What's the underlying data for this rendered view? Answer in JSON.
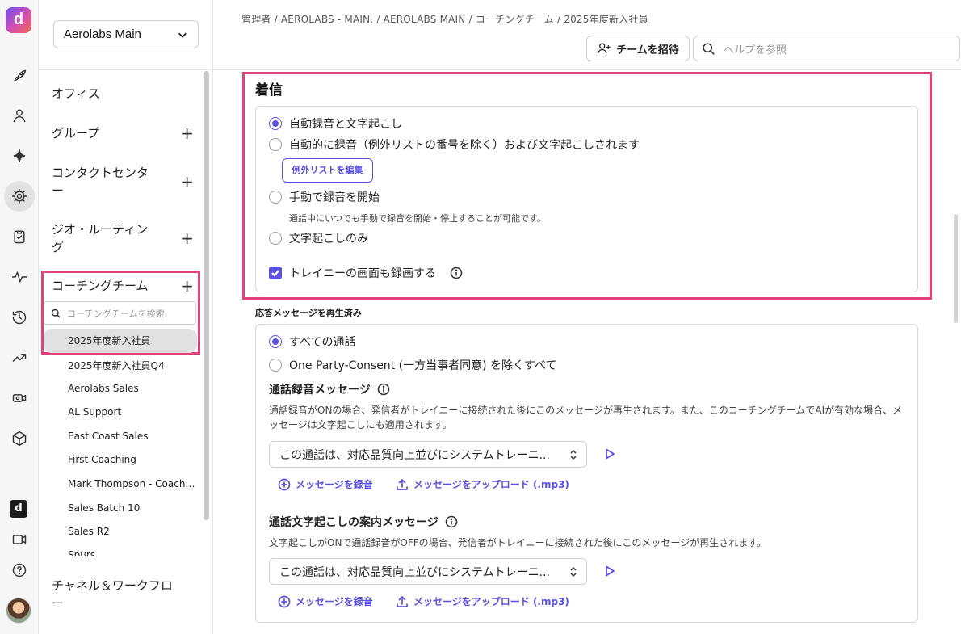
{
  "rail": {
    "logo": "d",
    "dbox": "d",
    "icons": [
      "rocket-icon",
      "user-icon",
      "sparkle-icon",
      "gear-icon",
      "clipboard-icon",
      "activity-icon",
      "history-icon",
      "trending-icon",
      "camera-settings-icon",
      "cube-icon",
      "d-app-icon",
      "video-icon",
      "help-icon"
    ]
  },
  "sidebar": {
    "workspace": "Aerolabs Main",
    "sections": [
      {
        "label": "オフィス",
        "plus": ""
      },
      {
        "label": "グループ",
        "plus": "+"
      },
      {
        "label": "コンタクトセンター",
        "plus": "+"
      },
      {
        "label": "ジオ・ルーティング",
        "plus": "+"
      },
      {
        "label": "コーチングチーム",
        "plus": "+"
      }
    ],
    "coaching_search_placeholder": "コーチングチームを検索",
    "selected_team": "2025年度新入社員",
    "teams": [
      "2025年度新入社員Q4",
      "Aerolabs Sales",
      "AL Support",
      "East Coast Sales",
      "First Coaching",
      "Mark Thompson - Coaching",
      "Sales Batch 10",
      "Sales R2",
      "Spurs"
    ],
    "bottom_section": "チャネル＆ワークフロー"
  },
  "header": {
    "breadcrumb": "管理者 / AEROLABS - MAIN. / AEROLABS MAIN / コーチングチーム / 2025年度新入社員",
    "invite_label": "チームを招待",
    "help_placeholder": "ヘルプを参照"
  },
  "incoming": {
    "title": "着信",
    "options": [
      "自動録音と文字起こし",
      "自動的に録音（例外リストの番号を除く）および文字起こしされます",
      "手動で録音を開始",
      "文字起こしのみ"
    ],
    "selected_index": 0,
    "edit_exceptions_label": "例外リストを編集",
    "manual_note": "通話中にいつでも手動で録音を開始・停止することが可能です。",
    "record_screen_label": "トレイニーの画面も録画する",
    "record_screen_checked": true
  },
  "answer_message": {
    "label": "応答メッセージを再生済み",
    "options": [
      "すべての通話",
      "One Party-Consent (一方当事者同意) を除くすべて"
    ],
    "selected_index": 0,
    "recording_message": {
      "title": "通話録音メッセージ",
      "description": "通話録音がONの場合、発信者がトレイニーに接続された後にこのメッセージが再生されます。また、このコーチングチームでAIが有効な場合、メッセージは文字起こしにも適用されます。",
      "selected": "この通話は、対応品質向上並びにシステムトレーニ...",
      "record_link": "メッセージを録音",
      "upload_link": "メッセージをアップロード (.mp3)"
    },
    "transcription_message": {
      "title": "通話文字起こしの案内メッセージ",
      "description": "文字起こしがONで通話録音がOFFの場合、発信者がトレイニーに接続された後にこのメッセージが再生されます。",
      "selected": "この通話は、対応品質向上並びにシステムトレーニ...",
      "record_link": "メッセージを録音",
      "upload_link": "メッセージをアップロード (.mp3)"
    }
  },
  "colors": {
    "accent": "#5b50e6",
    "highlight": "#e2417b"
  }
}
